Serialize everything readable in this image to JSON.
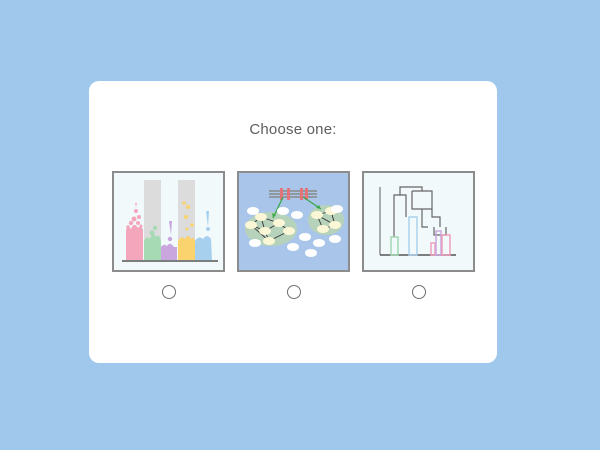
{
  "prompt": {
    "text": "Choose one:"
  },
  "options": [
    {
      "icon": "bar-chart-illustration-icon",
      "selected": false
    },
    {
      "icon": "network-diagram-illustration-icon",
      "selected": false
    },
    {
      "icon": "dendrogram-illustration-icon",
      "selected": false
    }
  ],
  "colors": {
    "background": "#a0c8ec",
    "card": "#ffffff",
    "border": "#8c8c8c",
    "text": "#5e5e5e"
  }
}
